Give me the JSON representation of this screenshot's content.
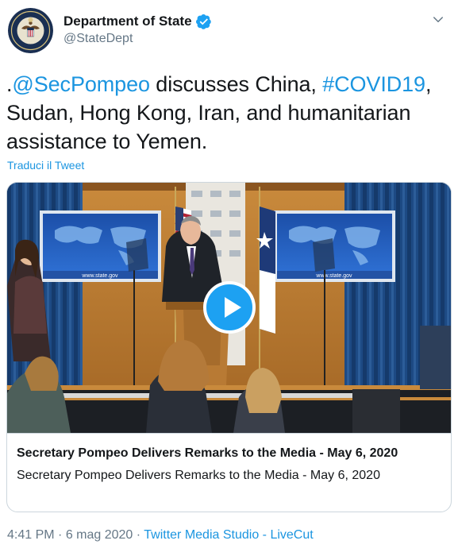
{
  "author": {
    "display_name": "Department of State",
    "handle": "@StateDept"
  },
  "tweet": {
    "prefix": ".",
    "mention": "@SecPompeo",
    "text_1": " discusses China, ",
    "hashtag": "#COVID19",
    "text_2": ", Sudan, Hong Kong, Iran, and humanitarian assistance to Yemen.",
    "translate_label": "Traduci il Tweet"
  },
  "card": {
    "title": "Secretary Pompeo Delivers Remarks to the Media - May 6, 2020",
    "description": "Secretary Pompeo Delivers Remarks to the Media - May 6, 2020",
    "screen_url_left": "www.state.gov",
    "screen_url_right": "www.state.gov"
  },
  "meta": {
    "time": "4:41 PM",
    "separator_1": " · ",
    "date": "6 mag 2020",
    "separator_2": " · ",
    "source": "Twitter Media Studio - LiveCut"
  },
  "icons": {
    "verified": "verified-badge-icon",
    "chevron": "chevron-down-icon",
    "play": "play-icon"
  },
  "colors": {
    "link": "#1b95e0",
    "verified": "#1da1f2",
    "muted": "#657786",
    "play": "#1da1f2"
  }
}
